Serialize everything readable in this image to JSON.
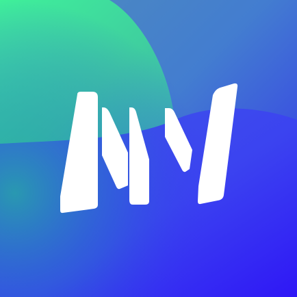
{
  "icon": {
    "logo_name": "nn-monogram-icon",
    "colors": {
      "background_blue": "#3a2ff4",
      "top_right_blue": "#4f86c0",
      "top_left_green": "#43ef9a",
      "bottom_left_teal": "#2b98c0",
      "logo_white": "#ffffff"
    }
  }
}
